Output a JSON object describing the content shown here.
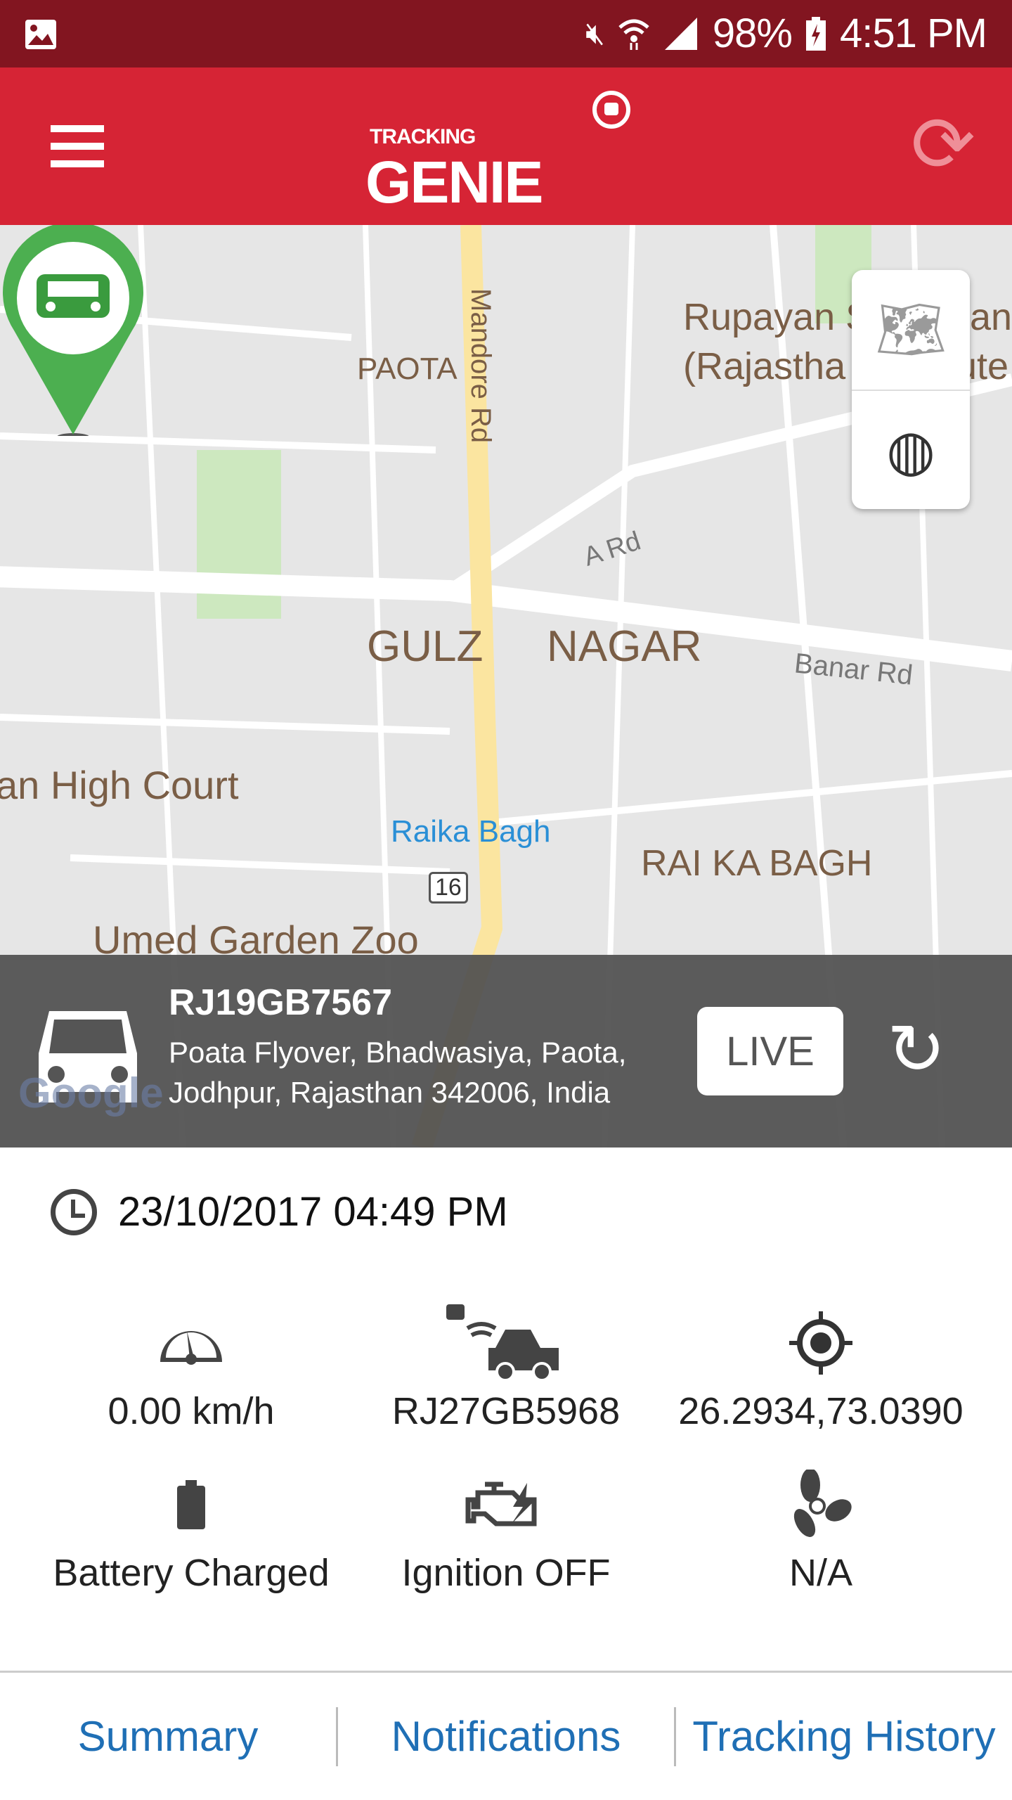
{
  "status_bar": {
    "battery": "98%",
    "time": "4:51 PM",
    "icons": [
      "image-icon",
      "mute-icon",
      "wifi-icon",
      "signal-icon",
      "battery-charging-icon"
    ]
  },
  "header": {
    "logo_text_top": "TRACKING",
    "logo_text_main": "GENIE",
    "menu_icon": "hamburger-icon",
    "refresh_icon": "sync-icon"
  },
  "map": {
    "labels": {
      "paota": "PAOTA",
      "mandore": "Mandore Rd",
      "rupayan1": "Rupayan S",
      "rupayan1b": "an",
      "rupayan2": "(Rajastha",
      "rupayan2b": "ute",
      "ard": "A Rd",
      "gulzar1": "GULZ",
      "gulzar2": "NAGAR",
      "banar": "Banar Rd",
      "court": "an High Court",
      "raika": "Raika Bagh",
      "hwy": "16",
      "raikabagh": "RAI KA BAGH",
      "zoo": "Umed Garden Zoo",
      "google": "Google"
    },
    "accent": "#4caf50"
  },
  "vehicle": {
    "plate": "RJ19GB7567",
    "address": "Poata Flyover, Bhadwasiya, Paota, Jodhpur, Rajasthan 342006, India",
    "live_label": "LIVE"
  },
  "details": {
    "timestamp": "23/10/2017 04:49 PM",
    "speed": "0.00 km/h",
    "device": "RJ27GB5968",
    "coords": "26.2934,73.0390",
    "battery": "Battery Charged",
    "ignition": "Ignition OFF",
    "ac": "N/A"
  },
  "tabs": [
    "Summary",
    "Notifications",
    "Tracking History"
  ],
  "colors": {
    "status_bar": "#821520",
    "header": "#d62435",
    "tab_text": "#1f6fb5"
  }
}
